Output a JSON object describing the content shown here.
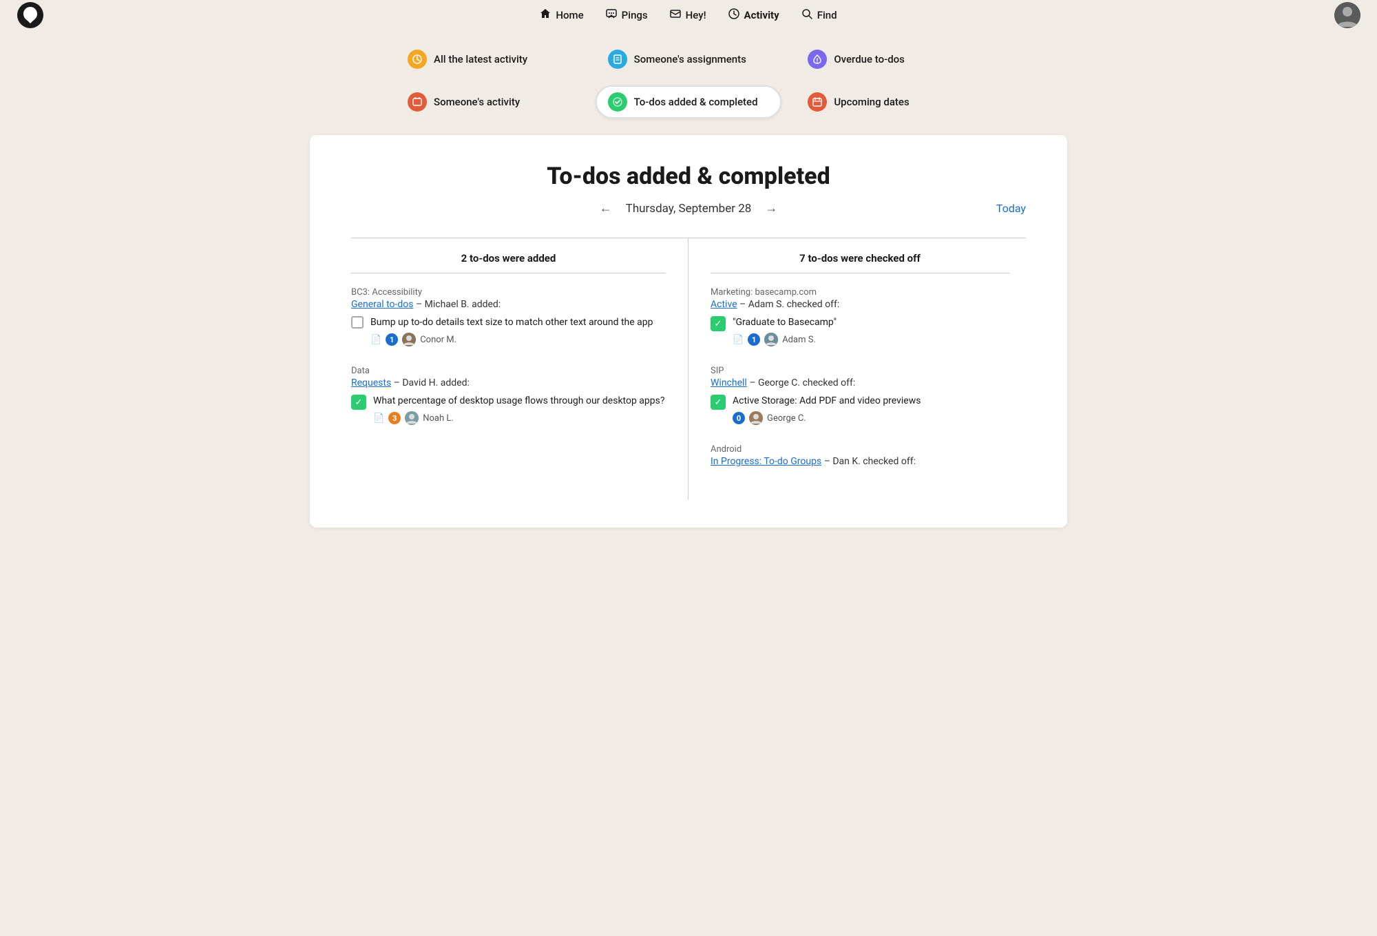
{
  "nav": {
    "logo_label": "Basecamp",
    "items": [
      {
        "id": "home",
        "label": "Home",
        "icon": "⛺"
      },
      {
        "id": "pings",
        "label": "Pings",
        "icon": "💬"
      },
      {
        "id": "hey",
        "label": "Hey!",
        "icon": "📋"
      },
      {
        "id": "activity",
        "label": "Activity",
        "icon": "◑",
        "active": true
      },
      {
        "id": "find",
        "label": "Find",
        "icon": "🔍"
      }
    ]
  },
  "sub_nav": {
    "items": [
      {
        "id": "latest",
        "label": "All the latest activity",
        "icon_color": "#f5a623",
        "icon": "🕐"
      },
      {
        "id": "assignments",
        "label": "Someone's assignments",
        "icon_color": "#29abe2",
        "icon": "📋"
      },
      {
        "id": "overdue",
        "label": "Overdue to-dos",
        "icon_color": "#7b68ee",
        "icon": "🔔"
      },
      {
        "id": "someones",
        "label": "Someone's activity",
        "icon_color": "#e05c3a",
        "icon": "💼"
      },
      {
        "id": "todos",
        "label": "To-dos added & completed",
        "icon_color": "#2ecc71",
        "icon": "✓",
        "active": true
      },
      {
        "id": "upcoming",
        "label": "Upcoming dates",
        "icon_color": "#e05c3a",
        "icon": "📅"
      }
    ]
  },
  "main": {
    "page_title": "To-dos added & completed",
    "date_label": "Thursday, September 28",
    "today_label": "Today",
    "col_left_header": "2 to-dos were added",
    "col_right_header": "7 to-dos were checked off",
    "left_entries": [
      {
        "project": "BC3: Accessibility",
        "link_text": "General to-dos",
        "action": "– Michael B. added:",
        "checked": false,
        "todo_text": "Bump up to-do details text size to match other text around the app",
        "meta_doc": "📄",
        "meta_count": "1",
        "meta_avatar": "C",
        "meta_name": "Conor M."
      },
      {
        "project": "Data",
        "link_text": "Requests",
        "action": "– David H. added:",
        "checked": true,
        "todo_text": "What percentage of desktop usage flows through our desktop apps?",
        "meta_doc": "📄",
        "meta_count": "3",
        "meta_avatar": "N",
        "meta_name": "Noah L."
      }
    ],
    "right_entries": [
      {
        "project": "Marketing: basecamp.com",
        "link_text": "Active",
        "action": "– Adam S. checked off:",
        "checked": true,
        "todo_text": "\"Graduate to Basecamp\"",
        "meta_doc": "📄",
        "meta_count": "1",
        "meta_avatar": "A",
        "meta_name": "Adam S."
      },
      {
        "project": "SIP",
        "link_text": "Winchell",
        "action": "– George C. checked off:",
        "checked": true,
        "todo_text": "Active Storage: Add PDF and video previews",
        "meta_count": "0",
        "meta_avatar": "G",
        "meta_name": "George C."
      },
      {
        "project": "Android",
        "link_text": "In Progress: To-do Groups",
        "action": "– Dan K. checked off:",
        "checked": false,
        "todo_text": "",
        "meta_count": "",
        "meta_avatar": "",
        "meta_name": ""
      }
    ]
  }
}
